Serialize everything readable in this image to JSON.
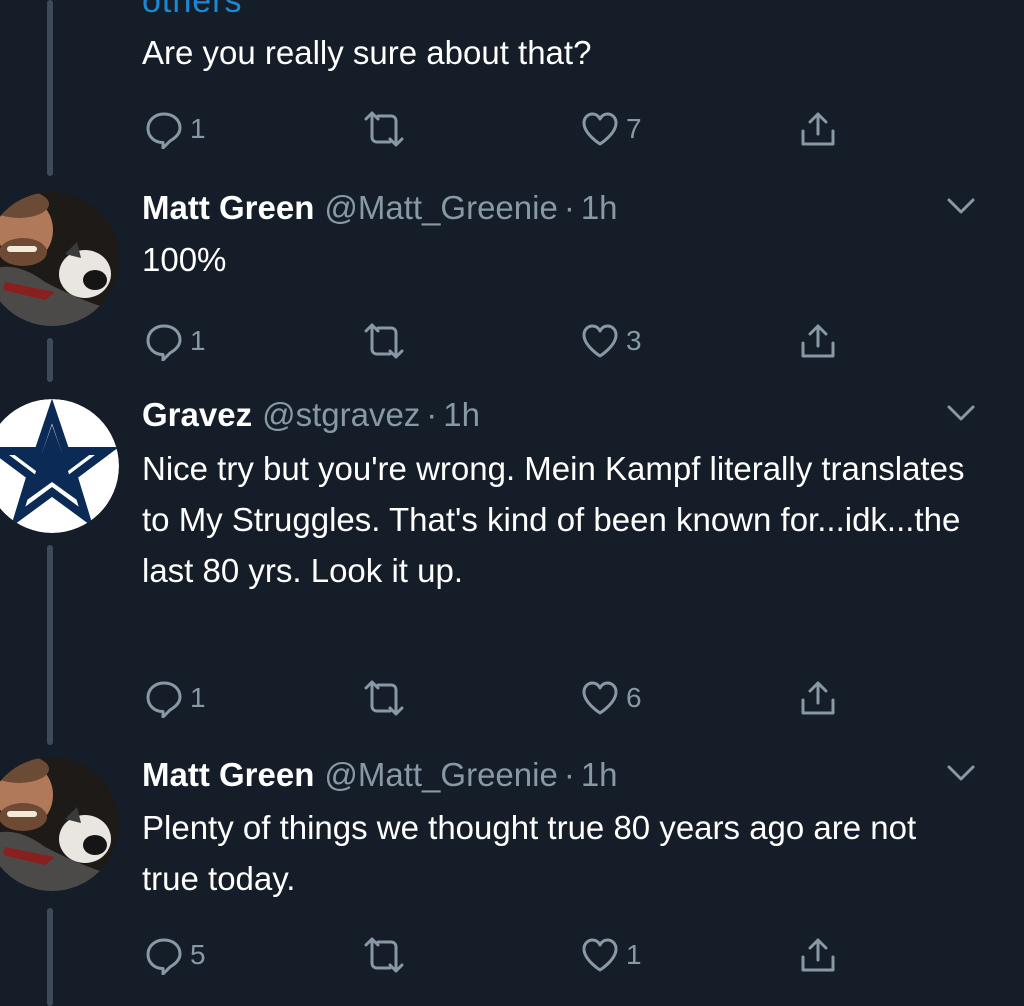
{
  "thread": {
    "truncated_text": "others",
    "top_reply": {
      "text": "Are you really sure about that?",
      "reply_count": "1",
      "like_count": "7"
    },
    "tweets": [
      {
        "name": "Matt Green",
        "handle": "@Matt_Greenie",
        "dot": "·",
        "time": "1h",
        "text": "100%",
        "reply_count": "1",
        "like_count": "3"
      },
      {
        "name": "Gravez",
        "handle": "@stgravez",
        "dot": "·",
        "time": "1h",
        "text": "Nice try but you're wrong. Mein Kampf literally translates to My Struggles. That's kind of been known for...idk...the last 80 yrs. Look it up.",
        "reply_count": "1",
        "like_count": "6"
      },
      {
        "name": "Matt Green",
        "handle": "@Matt_Greenie",
        "dot": "·",
        "time": "1h",
        "text": "Plenty of things we thought true 80 years ago are not true today.",
        "reply_count": "5",
        "like_count": "1"
      }
    ]
  },
  "icons": {
    "reply": "speech-bubble-icon",
    "retweet": "retweet-arrows-icon",
    "like": "heart-outline-icon",
    "share": "share-upload-icon",
    "caret": "chevron-down-icon"
  },
  "colors": {
    "background": "#151d28",
    "text": "#ffffff",
    "muted": "#8899a6",
    "thread_line": "#3d4a59",
    "link": "#1d9bf0"
  }
}
